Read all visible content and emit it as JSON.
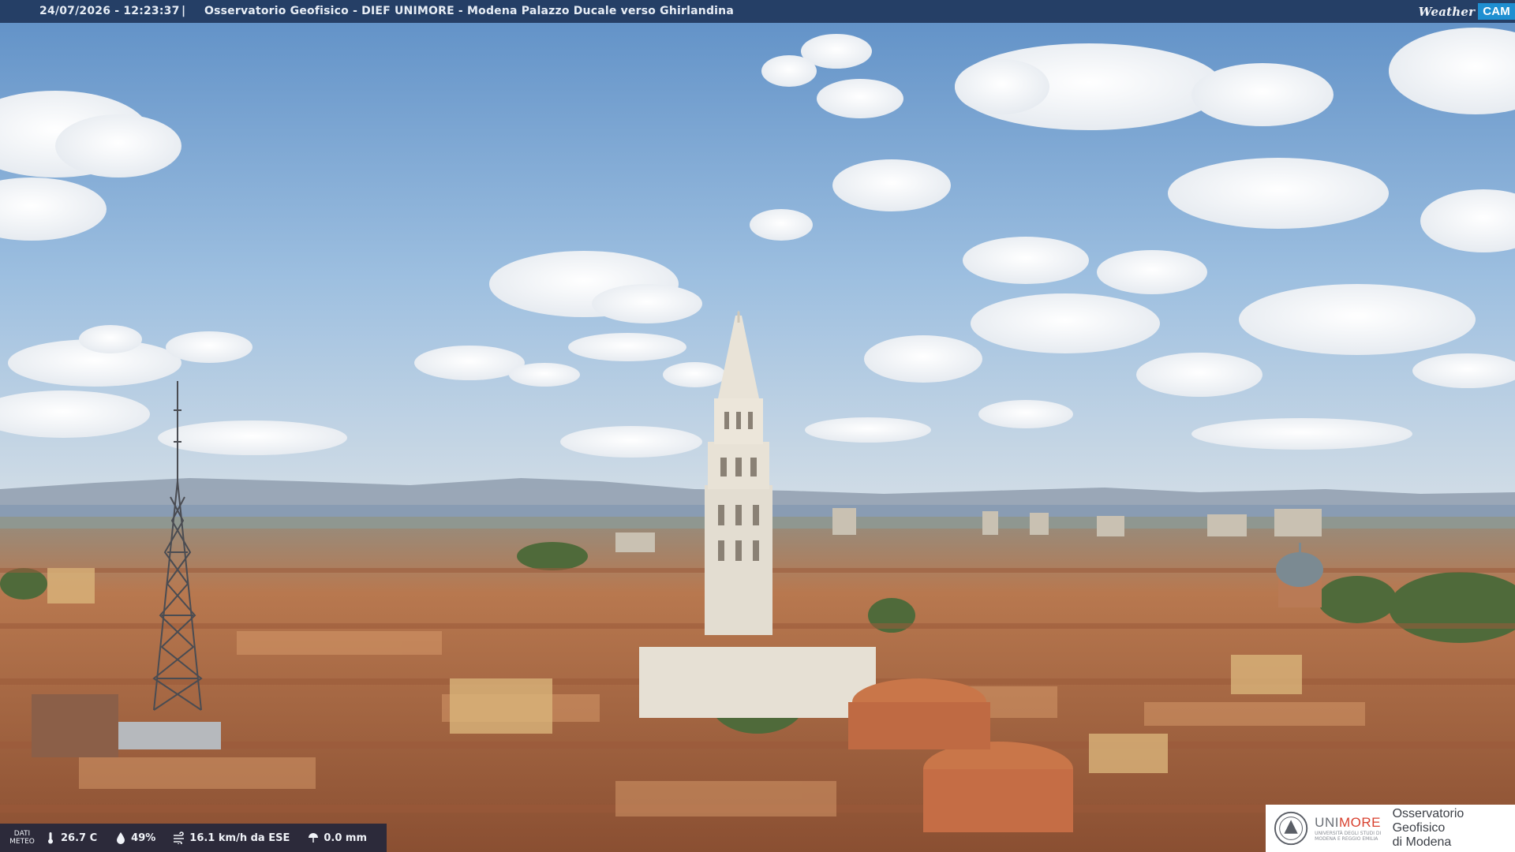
{
  "header": {
    "datetime": "24/07/2026 - 12:23:37",
    "separator": "|",
    "title": "Osservatorio Geofisico - DIEF UNIMORE - Modena Palazzo Ducale verso Ghirlandina"
  },
  "brand": {
    "weather": "Weather",
    "cam": "CAM"
  },
  "meteo": {
    "label_line1": "DATI",
    "label_line2": "METEO",
    "temperature": "26.7 C",
    "humidity": "49%",
    "wind": "16.1 km/h da ESE",
    "rain": "0.0 mm",
    "icons": [
      "thermometer-icon",
      "humidity-icon",
      "wind-icon",
      "rain-gauge-icon"
    ]
  },
  "logo": {
    "uni_grey": "UNI",
    "uni_red": "MORE",
    "uni_sub": "UNIVERSITÀ DEGLI STUDI DI MODENA E REGGIO EMILIA",
    "observatory_line1": "Osservatorio Geofisico",
    "observatory_line2": "di Modena"
  },
  "colors": {
    "sky": "#7fa6cf",
    "roofs": "#b8714a",
    "tower": "#e6e0d4",
    "accent": "#1f8fd1"
  }
}
